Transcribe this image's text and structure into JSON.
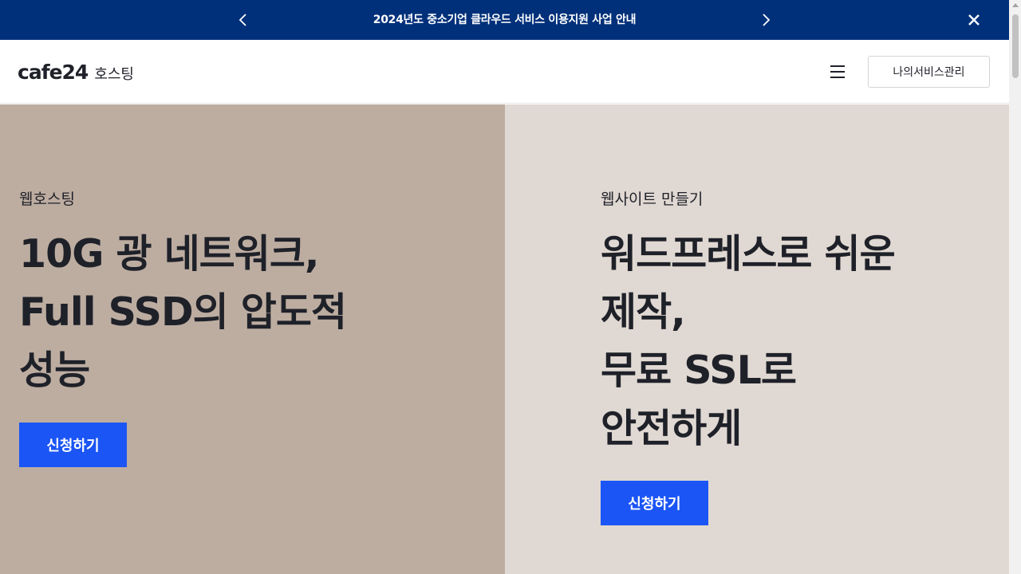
{
  "banner": {
    "text": "2024년도 중소기업 클라우드 서비스 이용지원 사업 안내",
    "prev_icon": "chevron-left-icon",
    "next_icon": "chevron-right-icon",
    "close_icon": "close-icon",
    "bg_color": "#00307a"
  },
  "header": {
    "logo_mark": "cafe24",
    "logo_sub": "호스팅",
    "menu_icon": "hamburger-menu-icon",
    "my_service_label": "나의서비스관리"
  },
  "panels": [
    {
      "category": "웹호스팅",
      "title_lines": [
        "10G 광 네트워크,",
        "Full SSD의 압도적",
        "성능"
      ],
      "button_label": "신청하기",
      "bg_color": "#bdada1"
    },
    {
      "category": "웹사이트 만들기",
      "title_lines": [
        "워드프레스로 쉬운",
        "제작,",
        "무료 SSL로",
        "안전하게"
      ],
      "button_label": "신청하기",
      "bg_color": "#e0d8d2"
    }
  ],
  "accent_color": "#1b55f5"
}
